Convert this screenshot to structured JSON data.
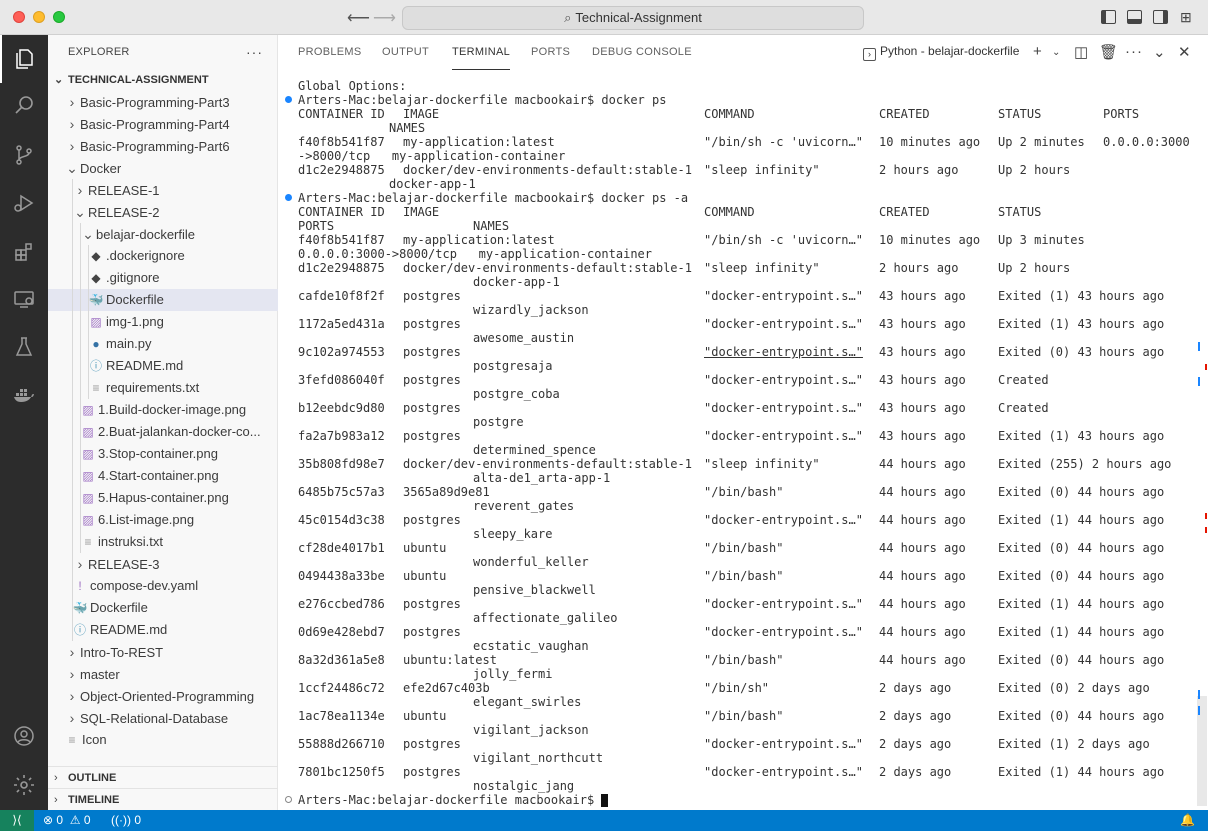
{
  "window": {
    "title": "Technical-Assignment"
  },
  "explorer": {
    "header": "EXPLORER",
    "more": "···",
    "workspace": "TECHNICAL-ASSIGNMENT",
    "tree": [
      {
        "label": "Basic-Programming-Part3",
        "kind": "folder",
        "level": 0,
        "expanded": false
      },
      {
        "label": "Basic-Programming-Part4",
        "kind": "folder",
        "level": 0,
        "expanded": false
      },
      {
        "label": "Basic-Programming-Part6",
        "kind": "folder",
        "level": 0,
        "expanded": false
      },
      {
        "label": "Docker",
        "kind": "folder",
        "level": 0,
        "expanded": true
      },
      {
        "label": "RELEASE-1",
        "kind": "folder",
        "level": 1,
        "expanded": false
      },
      {
        "label": "RELEASE-2",
        "kind": "folder",
        "level": 1,
        "expanded": true
      },
      {
        "label": "belajar-dockerfile",
        "kind": "folder",
        "level": 2,
        "expanded": true
      },
      {
        "label": ".dockerignore",
        "kind": "dockerignore",
        "level": 3
      },
      {
        "label": ".gitignore",
        "kind": "gitignore",
        "level": 3
      },
      {
        "label": "Dockerfile",
        "kind": "docker",
        "level": 3,
        "selected": true
      },
      {
        "label": "img-1.png",
        "kind": "image",
        "level": 3
      },
      {
        "label": "main.py",
        "kind": "python",
        "level": 3
      },
      {
        "label": "README.md",
        "kind": "info",
        "level": 3
      },
      {
        "label": "requirements.txt",
        "kind": "text",
        "level": 3
      },
      {
        "label": "1.Build-docker-image.png",
        "kind": "image",
        "level": 2
      },
      {
        "label": "2.Buat-jalankan-docker-co...",
        "kind": "image",
        "level": 2
      },
      {
        "label": "3.Stop-container.png",
        "kind": "image",
        "level": 2
      },
      {
        "label": "4.Start-container.png",
        "kind": "image",
        "level": 2
      },
      {
        "label": "5.Hapus-container.png",
        "kind": "image",
        "level": 2
      },
      {
        "label": "6.List-image.png",
        "kind": "image",
        "level": 2
      },
      {
        "label": "instruksi.txt",
        "kind": "text",
        "level": 2
      },
      {
        "label": "RELEASE-3",
        "kind": "folder",
        "level": 1,
        "expanded": false
      },
      {
        "label": "compose-dev.yaml",
        "kind": "yaml",
        "level": 1
      },
      {
        "label": "Dockerfile",
        "kind": "docker",
        "level": 1
      },
      {
        "label": "README.md",
        "kind": "info",
        "level": 1
      },
      {
        "label": "Intro-To-REST",
        "kind": "folder",
        "level": 0,
        "expanded": false
      },
      {
        "label": "master",
        "kind": "folder",
        "level": 0,
        "expanded": false
      },
      {
        "label": "Object-Oriented-Programming",
        "kind": "folder",
        "level": 0,
        "expanded": false
      },
      {
        "label": "SQL-Relational-Database",
        "kind": "folder",
        "level": 0,
        "expanded": false
      },
      {
        "label": "Icon",
        "kind": "file",
        "level": 0
      }
    ],
    "outline": "OUTLINE",
    "timeline": "TIMELINE"
  },
  "panel": {
    "tabs": [
      "PROBLEMS",
      "OUTPUT",
      "TERMINAL",
      "PORTS",
      "DEBUG CONSOLE"
    ],
    "active_tab": "TERMINAL",
    "terminal_name": "Python - belajar-dockerfile"
  },
  "terminal": {
    "global_options": "Global Options:",
    "prompt1": "Arters-Mac:belajar-dockerfile macbookair$ docker ps",
    "ps_header": {
      "id": "CONTAINER ID",
      "image": "IMAGE",
      "command": "COMMAND",
      "created": "CREATED",
      "status": "STATUS",
      "ports": "PORTS",
      "names": "NAMES"
    },
    "ps_rows": [
      {
        "id": "f40f8b541f87",
        "image": "my-application:latest",
        "command": "\"/bin/sh -c 'uvicorn…\"",
        "created": "10 minutes ago",
        "status": "Up 2 minutes",
        "ports": "0.0.0.0:3000",
        "wrap": "->8000/tcp   my-application-container"
      },
      {
        "id": "d1c2e2948875",
        "image": "docker/dev-environments-default:stable-1",
        "command": "\"sleep infinity\"",
        "created": "2 hours ago",
        "status": "Up 2 hours",
        "ports": "",
        "name": "docker-app-1"
      }
    ],
    "prompt2": "Arters-Mac:belajar-dockerfile macbookair$ docker ps -a",
    "psa_header_ports": "PORTS",
    "psa_rows": [
      {
        "id": "f40f8b541f87",
        "image": "my-application:latest",
        "command": "\"/bin/sh -c 'uvicorn…\"",
        "created": "10 minutes ago",
        "status": "Up 3 minutes",
        "wrap": "0.0.0.0:3000->8000/tcp   my-application-container"
      },
      {
        "id": "d1c2e2948875",
        "image": "docker/dev-environments-default:stable-1",
        "command": "\"sleep infinity\"",
        "created": "2 hours ago",
        "status": "Up 2 hours",
        "name": "docker-app-1"
      },
      {
        "id": "cafde10f8f2f",
        "image": "postgres",
        "command": "\"docker-entrypoint.s…\"",
        "created": "43 hours ago",
        "status": "Exited (1) 43 hours ago",
        "name": "wizardly_jackson"
      },
      {
        "id": "1172a5ed431a",
        "image": "postgres",
        "command": "\"docker-entrypoint.s…\"",
        "created": "43 hours ago",
        "status": "Exited (1) 43 hours ago",
        "name": "awesome_austin"
      },
      {
        "id": "9c102a974553",
        "image": "postgres",
        "command": "\"docker-entrypoint.s…\"",
        "created": "43 hours ago",
        "status": "Exited (0) 43 hours ago",
        "name": "postgresaja",
        "underline": true
      },
      {
        "id": "3fefd086040f",
        "image": "postgres",
        "command": "\"docker-entrypoint.s…\"",
        "created": "43 hours ago",
        "status": "Created",
        "name": "postgre_coba"
      },
      {
        "id": "b12eebdc9d80",
        "image": "postgres",
        "command": "\"docker-entrypoint.s…\"",
        "created": "43 hours ago",
        "status": "Created",
        "name": "postgre"
      },
      {
        "id": "fa2a7b983a12",
        "image": "postgres",
        "command": "\"docker-entrypoint.s…\"",
        "created": "43 hours ago",
        "status": "Exited (1) 43 hours ago",
        "name": "determined_spence"
      },
      {
        "id": "35b808fd98e7",
        "image": "docker/dev-environments-default:stable-1",
        "command": "\"sleep infinity\"",
        "created": "44 hours ago",
        "status": "Exited (255) 2 hours ago",
        "name": "alta-de1_arta-app-1"
      },
      {
        "id": "6485b75c57a3",
        "image": "3565a89d9e81",
        "command": "\"/bin/bash\"",
        "created": "44 hours ago",
        "status": "Exited (0) 44 hours ago",
        "name": "reverent_gates"
      },
      {
        "id": "45c0154d3c38",
        "image": "postgres",
        "command": "\"docker-entrypoint.s…\"",
        "created": "44 hours ago",
        "status": "Exited (1) 44 hours ago",
        "name": "sleepy_kare"
      },
      {
        "id": "cf28de4017b1",
        "image": "ubuntu",
        "command": "\"/bin/bash\"",
        "created": "44 hours ago",
        "status": "Exited (0) 44 hours ago",
        "name": "wonderful_keller"
      },
      {
        "id": "0494438a33be",
        "image": "ubuntu",
        "command": "\"/bin/bash\"",
        "created": "44 hours ago",
        "status": "Exited (0) 44 hours ago",
        "name": "pensive_blackwell"
      },
      {
        "id": "e276ccbed786",
        "image": "postgres",
        "command": "\"docker-entrypoint.s…\"",
        "created": "44 hours ago",
        "status": "Exited (1) 44 hours ago",
        "name": "affectionate_galileo"
      },
      {
        "id": "0d69e428ebd7",
        "image": "postgres",
        "command": "\"docker-entrypoint.s…\"",
        "created": "44 hours ago",
        "status": "Exited (1) 44 hours ago",
        "name": "ecstatic_vaughan"
      },
      {
        "id": "8a32d361a5e8",
        "image": "ubuntu:latest",
        "command": "\"/bin/bash\"",
        "created": "44 hours ago",
        "status": "Exited (0) 44 hours ago",
        "name": "jolly_fermi"
      },
      {
        "id": "1ccf24486c72",
        "image": "efe2d67c403b",
        "command": "\"/bin/sh\"",
        "created": "2 days ago",
        "status": "Exited (0) 2 days ago",
        "name": "elegant_swirles"
      },
      {
        "id": "1ac78ea1134e",
        "image": "ubuntu",
        "command": "\"/bin/bash\"",
        "created": "2 days ago",
        "status": "Exited (0) 44 hours ago",
        "name": "vigilant_jackson"
      },
      {
        "id": "55888d266710",
        "image": "postgres",
        "command": "\"docker-entrypoint.s…\"",
        "created": "2 days ago",
        "status": "Exited (1) 2 days ago",
        "name": "vigilant_northcutt"
      },
      {
        "id": "7801bc1250f5",
        "image": "postgres",
        "command": "\"docker-entrypoint.s…\"",
        "created": "2 days ago",
        "status": "Exited (1) 44 hours ago",
        "name": "nostalgic_jang"
      }
    ],
    "prompt3": "Arters-Mac:belajar-dockerfile macbookair$ "
  },
  "statusbar": {
    "errors": "0",
    "warnings": "0",
    "ports": "0"
  },
  "colors": {
    "accent": "#007acc",
    "activitybar": "#2c2c2c",
    "remote": "#16825d"
  }
}
